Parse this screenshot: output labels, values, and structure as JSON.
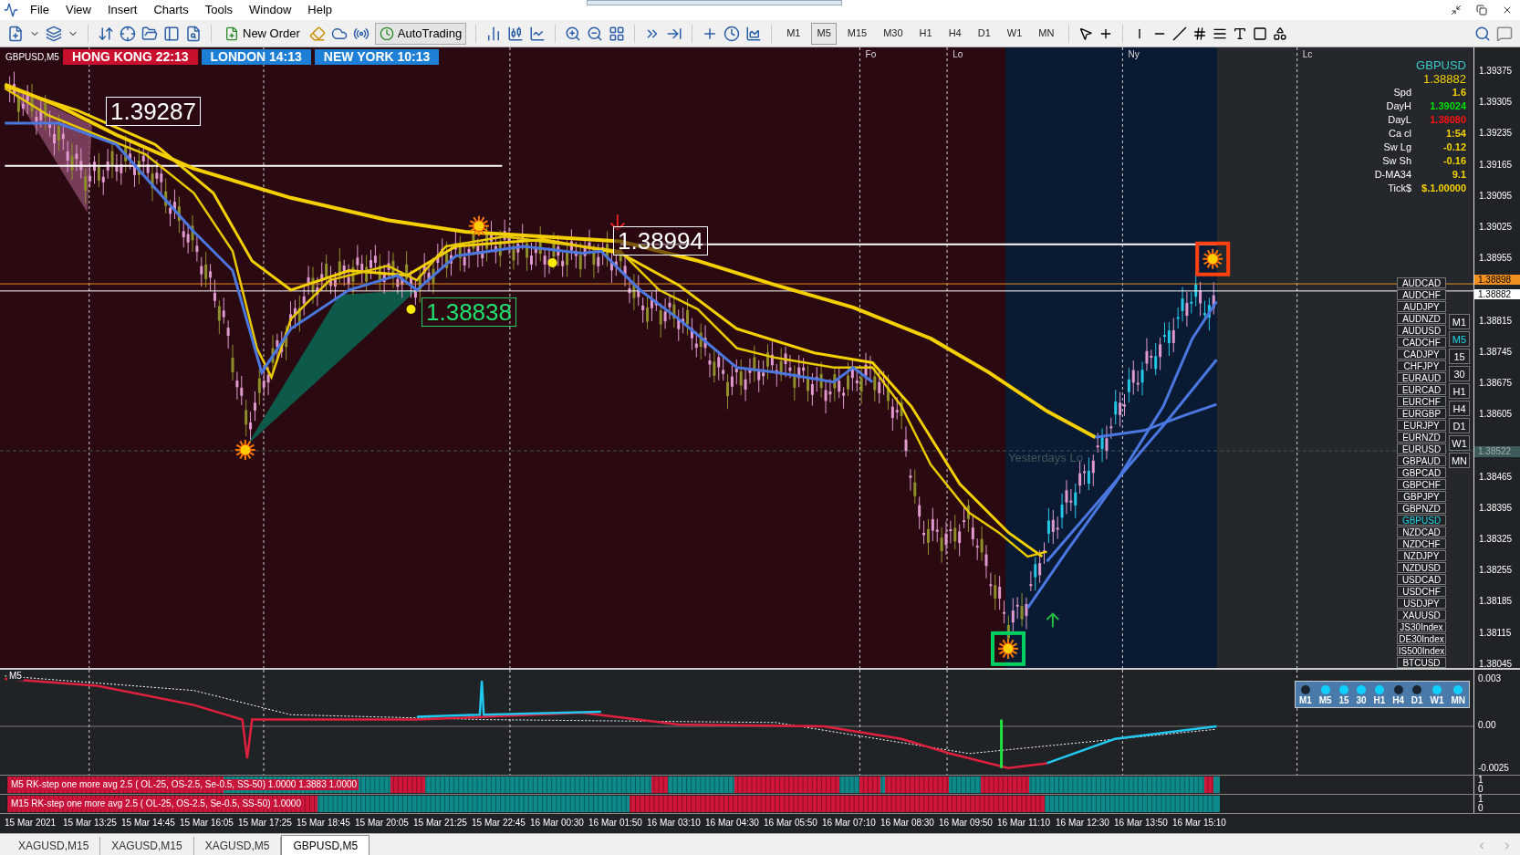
{
  "menu": [
    "File",
    "View",
    "Insert",
    "Charts",
    "Tools",
    "Window",
    "Help"
  ],
  "toolbar": {
    "new_order": "New Order",
    "auto_trading": "AutoTrading",
    "timeframes": [
      {
        "label": "M1",
        "selected": false
      },
      {
        "label": "M5",
        "selected": true
      },
      {
        "label": "M15",
        "selected": false
      },
      {
        "label": "M30",
        "selected": false
      },
      {
        "label": "H1",
        "selected": false
      },
      {
        "label": "H4",
        "selected": false
      },
      {
        "label": "D1",
        "selected": false
      },
      {
        "label": "W1",
        "selected": false
      },
      {
        "label": "MN",
        "selected": false
      }
    ]
  },
  "chart": {
    "title": "GBPUSD,M5",
    "sessions": [
      {
        "label": "HONG KONG 22:13",
        "color": "#c8102e"
      },
      {
        "label": "LONDON 14:13",
        "color": "#1e7fd6"
      },
      {
        "label": "NEW YORK 10:13",
        "color": "#1e7fd6"
      }
    ],
    "session_markers": [
      "Fo",
      "Lo",
      "Ny",
      "Lc"
    ],
    "high_label": "1.39287",
    "mid_label": "1.38994",
    "low_label": "1.38838",
    "yesterday_label": "Yesterdays Lo",
    "info_panel": {
      "symbol": "GBPUSD",
      "price": "1.38882",
      "rows": [
        {
          "label": "Spd",
          "value": "1.6",
          "color": "#f5d000"
        },
        {
          "label": "DayH",
          "value": "1.39024",
          "color": "#00e000"
        },
        {
          "label": "DayL",
          "value": "1.38080",
          "color": "#ff1010"
        },
        {
          "label": "Ca cl",
          "value": "1:54",
          "color": "#f5d000"
        },
        {
          "label": "Sw Lg",
          "value": "-0.12",
          "color": "#f5d000"
        },
        {
          "label": "Sw Sh",
          "value": "-0.16",
          "color": "#f5d000"
        },
        {
          "label": "D-MA34",
          "value": "9.1",
          "color": "#f5d000"
        },
        {
          "label": "Tick$",
          "value": "$.1.00000",
          "color": "#f5d000"
        }
      ]
    },
    "symbols": [
      {
        "label": "AUDCAD",
        "selected": false
      },
      {
        "label": "AUDCHF",
        "selected": false
      },
      {
        "label": "AUDJPY",
        "selected": false
      },
      {
        "label": "AUDNZD",
        "selected": false
      },
      {
        "label": "AUDUSD",
        "selected": false
      },
      {
        "label": "CADCHF",
        "selected": false
      },
      {
        "label": "CADJPY",
        "selected": false
      },
      {
        "label": "CHFJPY",
        "selected": false
      },
      {
        "label": "EURAUD",
        "selected": false
      },
      {
        "label": "EURCAD",
        "selected": false
      },
      {
        "label": "EURCHF",
        "selected": false
      },
      {
        "label": "EURGBP",
        "selected": false
      },
      {
        "label": "EURJPY",
        "selected": false
      },
      {
        "label": "EURNZD",
        "selected": false
      },
      {
        "label": "EURUSD",
        "selected": false
      },
      {
        "label": "GBPAUD",
        "selected": false
      },
      {
        "label": "GBPCAD",
        "selected": false
      },
      {
        "label": "GBPCHF",
        "selected": false
      },
      {
        "label": "GBPJPY",
        "selected": false
      },
      {
        "label": "GBPNZD",
        "selected": false
      },
      {
        "label": "GBPUSD",
        "selected": true
      },
      {
        "label": "NZDCAD",
        "selected": false
      },
      {
        "label": "NZDCHF",
        "selected": false
      },
      {
        "label": "NZDJPY",
        "selected": false
      },
      {
        "label": "NZDUSD",
        "selected": false
      },
      {
        "label": "USDCAD",
        "selected": false
      },
      {
        "label": "USDCHF",
        "selected": false
      },
      {
        "label": "USDJPY",
        "selected": false
      },
      {
        "label": "XAUUSD",
        "selected": false
      },
      {
        "label": "JS30Index",
        "selected": false
      },
      {
        "label": "DE30Index",
        "selected": false
      },
      {
        "label": "IS500Index",
        "selected": false
      },
      {
        "label": "BTCUSD",
        "selected": false
      }
    ],
    "timeframe_buttons": [
      {
        "label": "M1",
        "selected": false
      },
      {
        "label": "M5",
        "selected": true
      },
      {
        "label": "15",
        "selected": false
      },
      {
        "label": "30",
        "selected": false
      },
      {
        "label": "H1",
        "selected": false
      },
      {
        "label": "H4",
        "selected": false
      },
      {
        "label": "D1",
        "selected": false
      },
      {
        "label": "W1",
        "selected": false
      },
      {
        "label": "MN",
        "selected": false
      }
    ]
  },
  "price_axis": {
    "ticks": [
      "1.39375",
      "1.39305",
      "1.39235",
      "1.39165",
      "1.39095",
      "1.39025",
      "1.38955",
      "1.38815",
      "1.38745",
      "1.38675",
      "1.38605",
      "1.38465",
      "1.38395",
      "1.38325",
      "1.38255",
      "1.38185",
      "1.38115",
      "1.38045"
    ],
    "ask_label": "1.38898",
    "bid_label": "1.38882",
    "level_label": "1.38522"
  },
  "indicator": {
    "label": "M5",
    "axis": [
      "0.003",
      "0.00",
      "-0.0025"
    ],
    "timeframes": [
      {
        "label": "M1",
        "on": false
      },
      {
        "label": "M5",
        "on": true
      },
      {
        "label": "15",
        "on": true
      },
      {
        "label": "30",
        "on": true
      },
      {
        "label": "H1",
        "on": true
      },
      {
        "label": "H4",
        "on": false
      },
      {
        "label": "D1",
        "on": false
      },
      {
        "label": "W1",
        "on": true
      },
      {
        "label": "MN",
        "on": true
      }
    ]
  },
  "strips": [
    {
      "text": "M5 RK-step one more avg 2.5 ( OL-25, OS-2.5, Se-0.5, SS-50) 1.0000 1.3883 1.0000",
      "axis": [
        "1",
        "0"
      ]
    },
    {
      "text": "M15 RK-step one more avg 2.5 ( OL-25, OS-2.5, Se-0.5, SS-50) 1.0000",
      "axis": [
        "1",
        "0"
      ]
    }
  ],
  "time_axis": [
    "15 Mar 2021",
    "15 Mar 13:25",
    "15 Mar 14:45",
    "15 Mar 16:05",
    "15 Mar 17:25",
    "15 Mar 18:45",
    "15 Mar 20:05",
    "15 Mar 21:25",
    "15 Mar 22:45",
    "16 Mar 00:30",
    "16 Mar 01:50",
    "16 Mar 03:10",
    "16 Mar 04:30",
    "16 Mar 05:50",
    "16 Mar 07:10",
    "16 Mar 08:30",
    "16 Mar 09:50",
    "16 Mar 11:10",
    "16 Mar 12:30",
    "16 Mar 13:50",
    "16 Mar 15:10"
  ],
  "tabs": [
    {
      "label": "XAGUSD,M15",
      "selected": false
    },
    {
      "label": "XAGUSD,M15",
      "selected": false
    },
    {
      "label": "XAGUSD,M5",
      "selected": false
    },
    {
      "label": "GBPUSD,M5",
      "selected": true
    }
  ]
}
